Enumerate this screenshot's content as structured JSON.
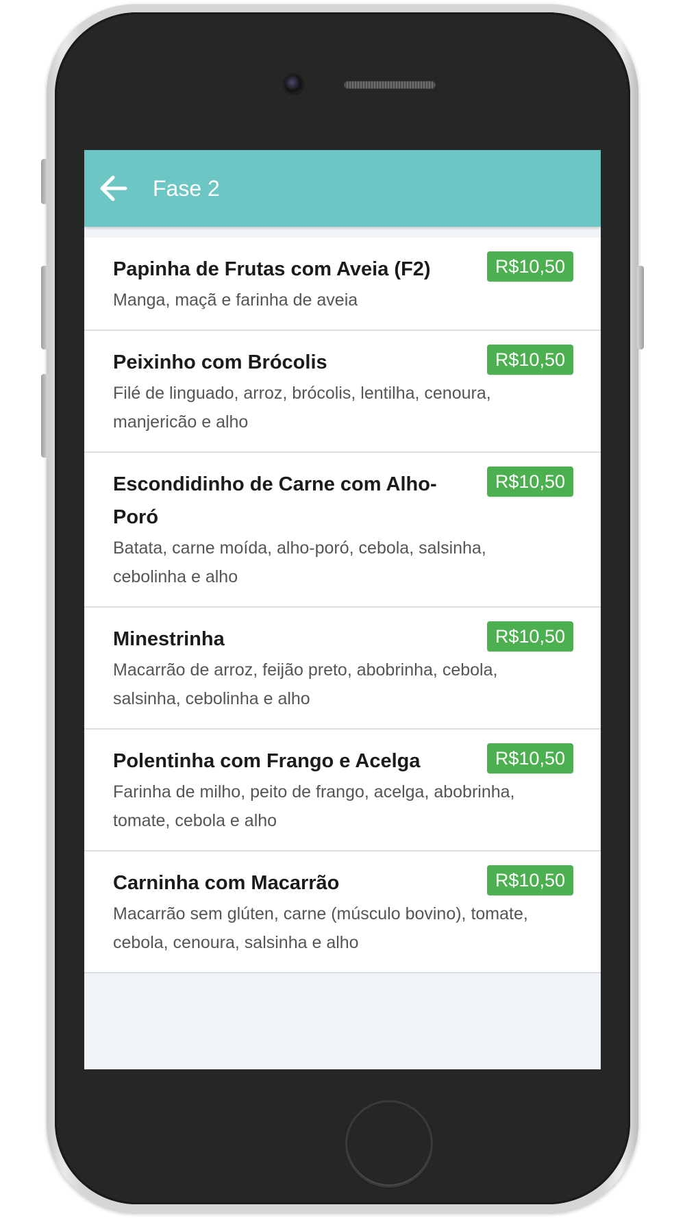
{
  "appbar": {
    "title": "Fase 2",
    "back_icon": "arrow-left-icon",
    "color": "#6bc6c4"
  },
  "price_badge_color": "#4caf50",
  "items": [
    {
      "name": "Papinha de Frutas com Aveia (F2)",
      "description": "Manga, maçã e farinha de aveia",
      "price": "R$10,50"
    },
    {
      "name": "Peixinho com Brócolis",
      "description": "Filé de linguado, arroz, brócolis, lentilha, cenoura, manjericão e alho",
      "price": "R$10,50"
    },
    {
      "name": "Escondidinho de Carne com Alho-Poró",
      "description": "Batata, carne moída, alho-poró, cebola, salsinha, cebolinha e alho",
      "price": "R$10,50"
    },
    {
      "name": "Minestrinha",
      "description": "Macarrão de arroz, feijão preto, abobrinha, cebola, salsinha, cebolinha e alho",
      "price": "R$10,50"
    },
    {
      "name": "Polentinha com Frango e Acelga",
      "description": "Farinha de milho, peito de frango, acelga, abobrinha, tomate, cebola e alho",
      "price": "R$10,50"
    },
    {
      "name": "Carninha com Macarrão",
      "description": "Macarrão sem glúten, carne (músculo bovino), tomate, cebola, cenoura, salsinha e alho",
      "price": "R$10,50"
    }
  ]
}
